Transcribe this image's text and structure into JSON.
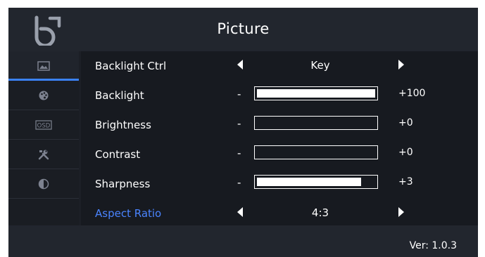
{
  "window": {
    "title": "Picture",
    "version": "Ver: 1.0.3"
  },
  "colors": {
    "background": "#1c1f26",
    "accent": "#3b82f6",
    "highlight_text": "#4a84ff"
  },
  "sidebar": {
    "items": [
      {
        "icon": "picture-icon",
        "active": true
      },
      {
        "icon": "palette-icon",
        "active": false
      },
      {
        "icon": "osd-icon",
        "label": "OSD",
        "active": false
      },
      {
        "icon": "tools-icon",
        "active": false
      },
      {
        "icon": "contrast-icon",
        "active": false
      },
      {
        "icon": "",
        "active": false
      }
    ]
  },
  "settings": [
    {
      "name": "Backlight Ctrl",
      "type": "choice",
      "value": "Key"
    },
    {
      "name": "Backlight",
      "type": "slider",
      "minus": "-",
      "value": "+100",
      "level": 1.0
    },
    {
      "name": "Brightness",
      "type": "slider",
      "minus": "-",
      "value": "+0",
      "level": 0.0
    },
    {
      "name": "Contrast",
      "type": "slider",
      "minus": "-",
      "value": "+0",
      "level": 0.0
    },
    {
      "name": "Sharpness",
      "type": "slider",
      "minus": "-",
      "value": "+3",
      "level": 0.88
    },
    {
      "name": "Aspect Ratio",
      "type": "choice",
      "value": "4:3",
      "highlight": true
    }
  ]
}
